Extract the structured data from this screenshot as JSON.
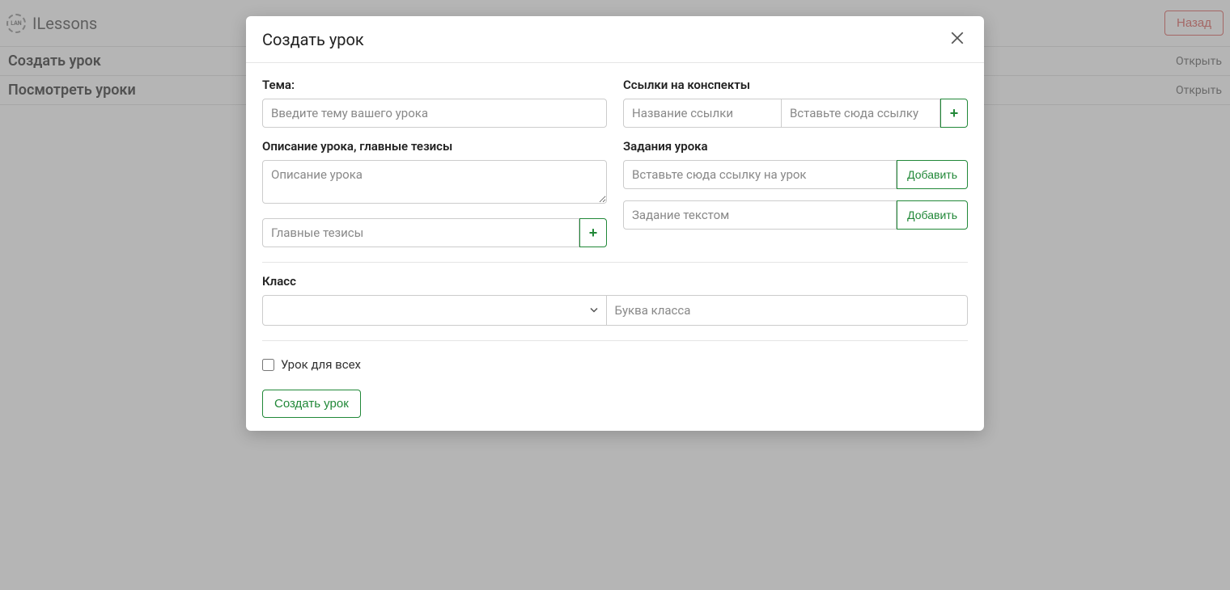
{
  "header": {
    "brand_abbr": "LAN",
    "brand_name": "ILessons",
    "back_label": "Назад"
  },
  "page": {
    "row1_title": "Создать урок",
    "row1_action": "Открыть",
    "row2_title": "Посмотреть уроки",
    "row2_action": "Открыть"
  },
  "modal": {
    "title": "Создать урок",
    "left": {
      "topic_label": "Тема:",
      "topic_placeholder": "Введите тему вашего урока",
      "desc_label": "Описание урока, главные тезисы",
      "desc_placeholder": "Описание урока",
      "thesis_placeholder": "Главные тезисы"
    },
    "right": {
      "links_label": "Ссылки на конспекты",
      "link_name_placeholder": "Название ссылки",
      "link_url_placeholder": "Вставьте сюда ссылку",
      "tasks_label": "Задания урока",
      "task_link_placeholder": "Вставьте сюда ссылку на урок",
      "task_text_placeholder": "Задание текстом",
      "add_label": "Добавить"
    },
    "class_label": "Класс",
    "class_letter_placeholder": "Буква класса",
    "for_all_label": "Урок для всех",
    "submit_label": "Создать урок",
    "plus_label": "+"
  }
}
